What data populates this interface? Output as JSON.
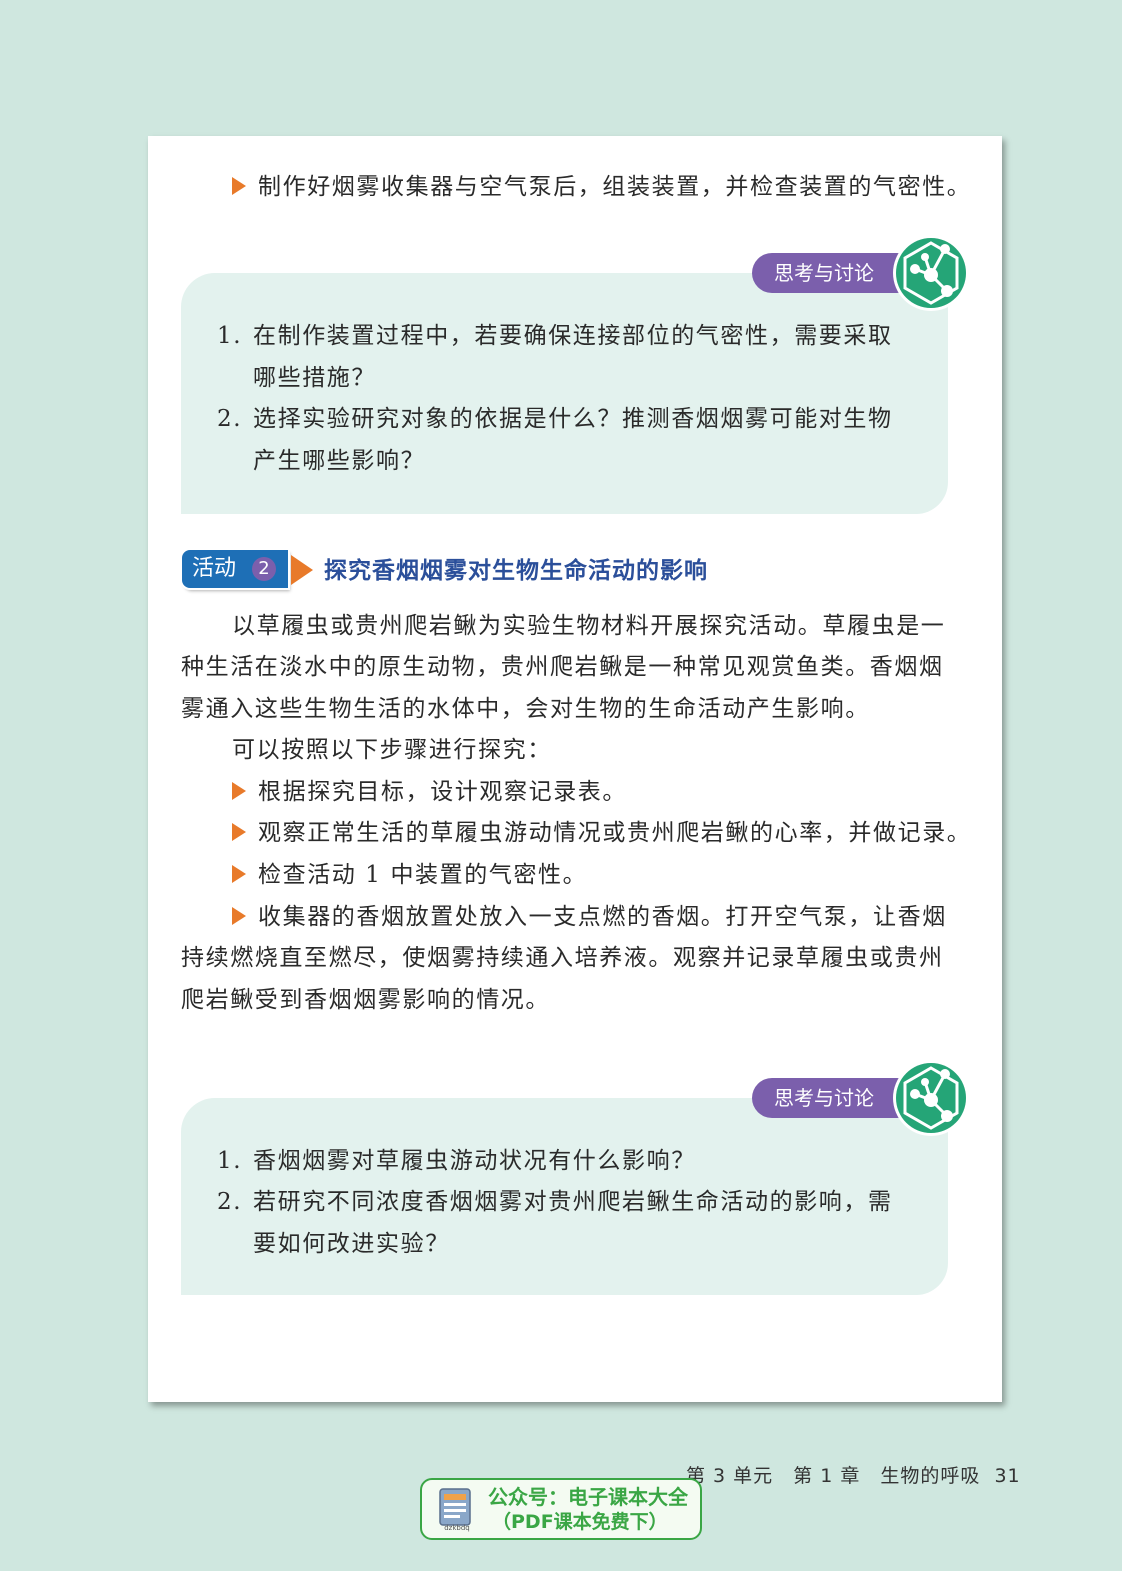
{
  "intro_step": "制作好烟雾收集器与空气泵后，组装装置，并检查装置的气密性。",
  "discussion1": {
    "tag": "思考与讨论",
    "q1_num": "1.",
    "q1_line1": "在制作装置过程中，若要确保连接部位的气密性，需要采取",
    "q1_line2": "哪些措施？",
    "q2_num": "2.",
    "q2_line1": "选择实验研究对象的依据是什么？推测香烟烟雾可能对生物",
    "q2_line2": "产生哪些影响？"
  },
  "activity": {
    "label": "活动",
    "number": "2",
    "title": "探究香烟烟雾对生物生命活动的影响"
  },
  "body": {
    "para1_line1": "以草履虫或贵州爬岩鳅为实验生物材料开展探究活动。草履虫是一",
    "para1_line2": "种生活在淡水中的原生动物，贵州爬岩鳅是一种常见观赏鱼类。香烟烟",
    "para1_line3": "雾通入这些生物生活的水体中，会对生物的生命活动产生影响。",
    "para2": "可以按照以下步骤进行探究：",
    "steps": [
      "根据探究目标，设计观察记录表。",
      "观察正常生活的草履虫游动情况或贵州爬岩鳅的心率，并做记录。",
      "检查活动 1 中装置的气密性。"
    ],
    "step4_line1": "收集器的香烟放置处放入一支点燃的香烟。打开空气泵，让香烟",
    "step4_line2": "持续燃烧直至燃尽，使烟雾持续通入培养液。观察并记录草履虫或贵州",
    "step4_line3": "爬岩鳅受到香烟烟雾影响的情况。"
  },
  "discussion2": {
    "tag": "思考与讨论",
    "q1_num": "1.",
    "q1_line1": "香烟烟雾对草履虫游动状况有什么影响？",
    "q2_num": "2.",
    "q2_line1": "若研究不同浓度香烟烟雾对贵州爬岩鳅生命活动的影响，需",
    "q2_line2": "要如何改进实验？"
  },
  "footer": {
    "text": "第 3 单元　第 1 章　生物的呼吸",
    "page_number": "31"
  },
  "watermark": {
    "line1": "公众号：电子课本大全",
    "line2": "（PDF课本免费下）",
    "icon_text": "dzkbdq"
  },
  "colors": {
    "background": "#cfe7df",
    "discussion_box": "#e3f2ee",
    "tag_purple": "#7b5fac",
    "icon_green": "#25a577",
    "arrow_orange": "#e87a2a",
    "activity_blue": "#1e6fb6",
    "title_blue": "#2b4f9a"
  }
}
